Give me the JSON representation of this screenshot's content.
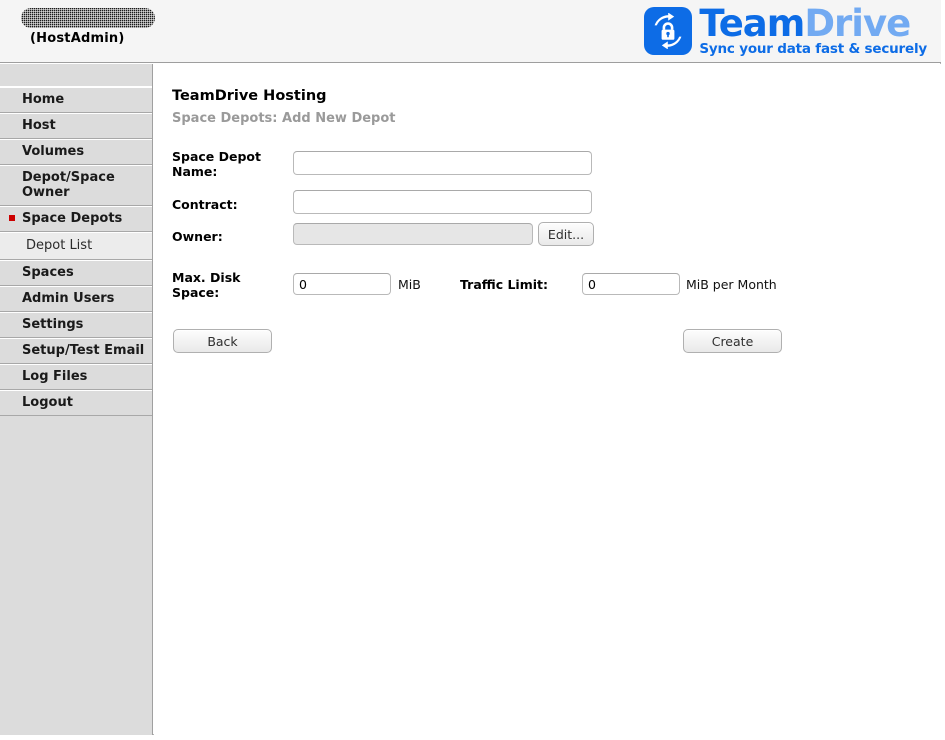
{
  "header": {
    "user_redacted": true,
    "user_role": "(HostAdmin)",
    "logo": {
      "icon_name": "teamdrive-lock-sync-icon",
      "word_primary": "Team",
      "word_secondary": "Drive",
      "tagline": "Sync your data fast & securely",
      "color_primary": "#0d6ce6",
      "color_secondary": "#72aaf2",
      "mark_background": "#0d6ce6"
    }
  },
  "sidebar": {
    "items": [
      {
        "label": "Home",
        "type": "main",
        "active": false
      },
      {
        "label": "Host",
        "type": "main",
        "active": false
      },
      {
        "label": "Volumes",
        "type": "main",
        "active": false
      },
      {
        "label": "Depot/Space Owner",
        "type": "main",
        "active": false
      },
      {
        "label": "Space Depots",
        "type": "main",
        "active": true
      },
      {
        "label": "Depot List",
        "type": "sub",
        "active": false
      },
      {
        "label": "Spaces",
        "type": "main",
        "active": false
      },
      {
        "label": "Admin Users",
        "type": "main",
        "active": false
      },
      {
        "label": "Settings",
        "type": "main",
        "active": false
      },
      {
        "label": "Setup/Test Email",
        "type": "main",
        "active": false
      },
      {
        "label": "Log Files",
        "type": "main",
        "active": false
      },
      {
        "label": "Logout",
        "type": "main",
        "active": false
      }
    ],
    "active_bullet_color": "#cc0000"
  },
  "main": {
    "title": "TeamDrive Hosting",
    "subtitle": "Space Depots: Add New Depot",
    "fields": {
      "space_depot_name": {
        "label": "Space Depot Name:",
        "value": "",
        "placeholder": ""
      },
      "contract": {
        "label": "Contract:",
        "value": "",
        "placeholder": ""
      },
      "owner": {
        "label": "Owner:",
        "value": "",
        "placeholder": "",
        "disabled": true,
        "edit_button": "Edit..."
      },
      "max_disk_space": {
        "label": "Max. Disk Space:",
        "value": "0",
        "unit": "MiB"
      },
      "traffic_limit": {
        "label": "Traffic Limit:",
        "value": "0",
        "unit": "MiB per Month"
      }
    },
    "buttons": {
      "back": "Back",
      "create": "Create"
    }
  }
}
